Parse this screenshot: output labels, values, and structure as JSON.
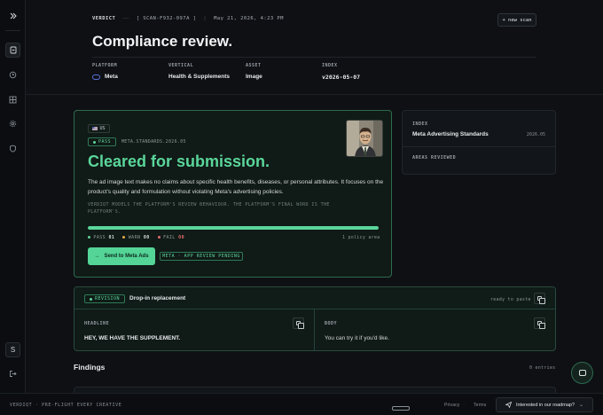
{
  "sidebar": {
    "icons": [
      "expand-icon",
      "scan-icon",
      "history-icon",
      "grid-icon",
      "settings-icon",
      "shield-icon"
    ],
    "account_initial": "S",
    "logout_icon": "logout-icon"
  },
  "header": {
    "label": "VERDICT",
    "scan_id": "SCAN-F932-097A",
    "timestamp": "May 21, 2026, 4:23 PM",
    "new_scan_label": "+ new scan",
    "title": "Compliance review.",
    "fields": [
      {
        "label": "PLATFORM",
        "value": "Meta"
      },
      {
        "label": "VERTICAL",
        "value": "Health & Supplements"
      },
      {
        "label": "ASSET",
        "value": "Image"
      },
      {
        "label": "INDEX",
        "value": "v2026-05-07"
      }
    ]
  },
  "result": {
    "region_badge": "US",
    "status_badge": "PASS",
    "standard_code": "META.STANDARDS.2026.05",
    "title": "Cleared for submission.",
    "body": "The ad image text makes no claims about specific health benefits, diseases, or personal attributes. It focuses on the product's quality and formulation without violating Meta's advertising policies.",
    "disclaimer": "VERDIQT MODELS THE PLATFORM'S REVIEW BEHAVIOUR. THE PLATFORM'S FINAL WORD IS THE PLATFORM'S.",
    "progress": 1.0,
    "tally": {
      "pass_label": "PASS",
      "pass_count": "01",
      "warn_label": "WARN",
      "warn_count": "00",
      "fail_label": "FAIL",
      "fail_count": "00"
    },
    "policy_count": "1 policy area",
    "send_button": "Send to Meta Ads",
    "pending_badge": "META · APP REVIEW PENDING",
    "colors": {
      "accent": "#5ad69a",
      "fail": "#e26d6d",
      "warn": "#e0a94a"
    }
  },
  "index_card": {
    "label": "INDEX",
    "name": "Meta Advertising Standards",
    "date": "2026.05",
    "areas_label": "AREAS REVIEWED"
  },
  "revision": {
    "badge": "REVISION",
    "title": "Drop-in replacement",
    "ready_label": "ready to paste",
    "headline_label": "HEADLINE",
    "headline_text": "HEY, WE HAVE THE SUPPLEMENT.",
    "body_label": "BODY",
    "body_text": "You can try it if you'd like."
  },
  "findings": {
    "title": "Findings",
    "count": "0 entries"
  },
  "footer": {
    "brand": "VERDIQT · PRE-FLIGHT EVERY CREATIVE",
    "privacy": "Privacy",
    "terms": "Terms",
    "roadmap": "Interested in our roadmap?"
  }
}
